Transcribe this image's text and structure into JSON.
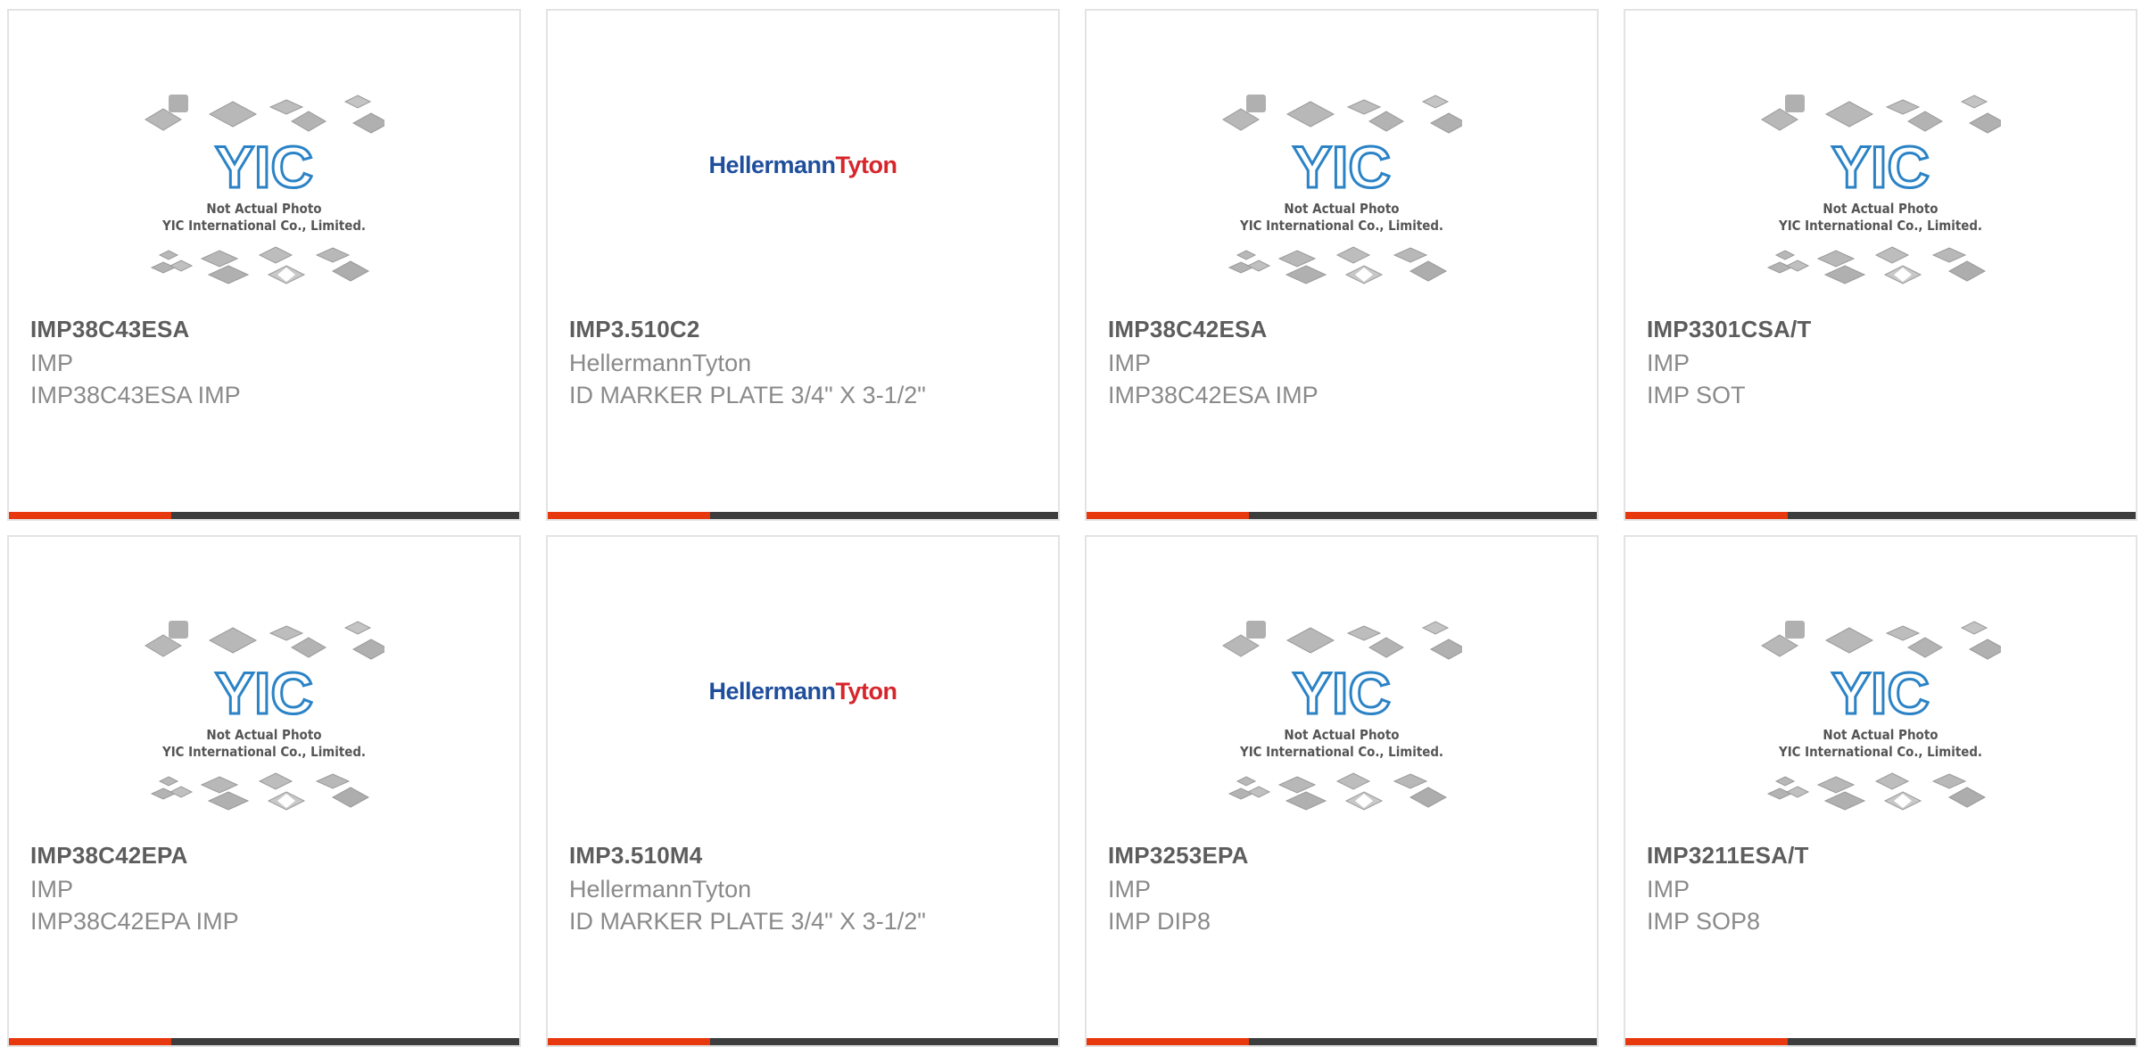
{
  "accent_color": "#e8380d",
  "bar_color": "#3d3d3d",
  "placeholder_image": {
    "logo_text": "YIC",
    "caption_line1": "Not Actual Photo",
    "caption_line2": "YIC International Co., Limited."
  },
  "brand_logo": {
    "part1": "Hellermann",
    "part2": "Tyton"
  },
  "products": [
    {
      "part_number": "IMP38C43ESA",
      "manufacturer": "IMP",
      "description": "IMP38C43ESA IMP",
      "image": "yic-placeholder"
    },
    {
      "part_number": "IMP3.510C2",
      "manufacturer": "HellermannTyton",
      "description": "ID MARKER PLATE 3/4\" X 3-1/2\"",
      "image": "hellermanntyton-logo"
    },
    {
      "part_number": "IMP38C42ESA",
      "manufacturer": "IMP",
      "description": "IMP38C42ESA IMP",
      "image": "yic-placeholder"
    },
    {
      "part_number": "IMP3301CSA/T",
      "manufacturer": "IMP",
      "description": "IMP SOT",
      "image": "yic-placeholder"
    },
    {
      "part_number": "IMP38C42EPA",
      "manufacturer": "IMP",
      "description": "IMP38C42EPA IMP",
      "image": "yic-placeholder"
    },
    {
      "part_number": "IMP3.510M4",
      "manufacturer": "HellermannTyton",
      "description": "ID MARKER PLATE 3/4\" X 3-1/2\"",
      "image": "hellermanntyton-logo"
    },
    {
      "part_number": "IMP3253EPA",
      "manufacturer": "IMP",
      "description": "IMP DIP8",
      "image": "yic-placeholder"
    },
    {
      "part_number": "IMP3211ESA/T",
      "manufacturer": "IMP",
      "description": "IMP SOP8",
      "image": "yic-placeholder"
    }
  ]
}
